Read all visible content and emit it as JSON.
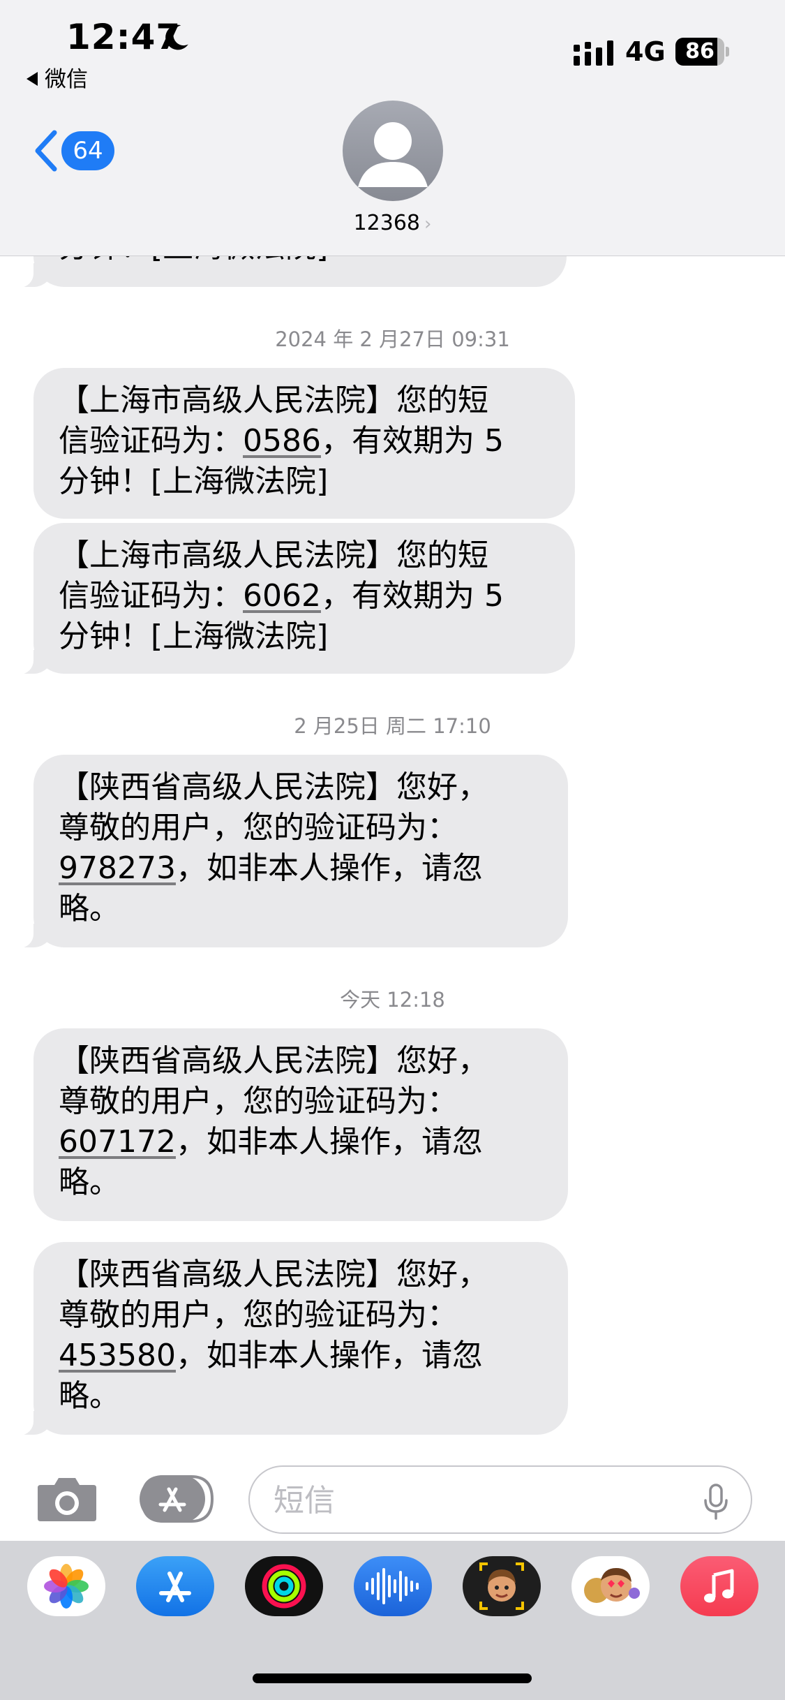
{
  "status_bar": {
    "time": "12:47",
    "back_app_label": "微信",
    "network": "4G",
    "battery_level": "86"
  },
  "header": {
    "unread_count": "64",
    "contact_name": "12368",
    "contact_chevron": "›"
  },
  "thread": {
    "partial_top_text": "分钟！[上海微法院]",
    "groups": [
      {
        "timestamp": "2024 年 2 月27日 09:31",
        "messages": [
          {
            "lines": [
              "【上海市高级人民法院】您的短",
              "信验证码为：",
              "，有效期为 5",
              "分钟！[上海微法院]"
            ],
            "code": "0586"
          },
          {
            "lines": [
              "【上海市高级人民法院】您的短",
              "信验证码为：",
              "，有效期为 5",
              "分钟！[上海微法院]"
            ],
            "code": "6062"
          }
        ]
      },
      {
        "timestamp": "2 月25日 周二 17:10",
        "messages": [
          {
            "lines": [
              "【陕西省高级人民法院】您好，",
              "尊敬的用户，您的验证码为：",
              "，如非本人操作，请忽",
              "略。"
            ],
            "code": "978273"
          }
        ]
      },
      {
        "timestamp": "今天 12:18",
        "messages": [
          {
            "lines": [
              "【陕西省高级人民法院】您好，",
              "尊敬的用户，您的验证码为：",
              "，如非本人操作，请忽",
              "略。"
            ],
            "code": "607172"
          },
          {
            "lines": [
              "【陕西省高级人民法院】您好，",
              "尊敬的用户，您的验证码为：",
              "，如非本人操作，请忽",
              "略。"
            ],
            "code": "453580"
          }
        ]
      }
    ]
  },
  "input_bar": {
    "placeholder": "短信"
  },
  "app_drawer": {
    "apps": [
      "photos-icon",
      "app-store-icon",
      "fitness-icon",
      "audio-message-icon",
      "memoji-icon",
      "memoji-stickers-icon",
      "music-icon"
    ]
  },
  "colors": {
    "accent": "#1f7cf6",
    "bubble_gray": "#e9e9eb",
    "timestamp_gray": "#8a8a8e",
    "music_red": "#f53b50"
  }
}
